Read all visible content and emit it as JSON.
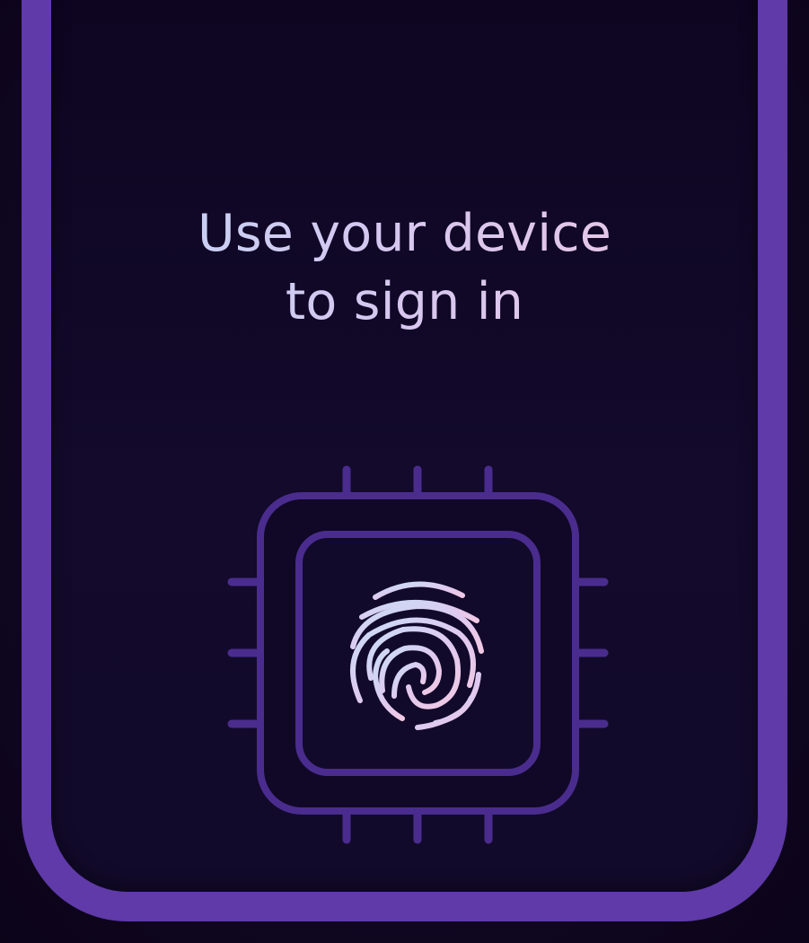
{
  "screen": {
    "headline_line1": "Use your device",
    "headline_line2": "to sign in"
  },
  "icons": {
    "chip": "chip-icon",
    "fingerprint": "fingerprint-icon"
  },
  "colors": {
    "background": "#0f0620",
    "frame": "#5f3aa8",
    "chip_stroke": "#4a2c8e",
    "text_gradient_start": "#bcd6f5",
    "text_gradient_end": "#f0c7e2"
  }
}
